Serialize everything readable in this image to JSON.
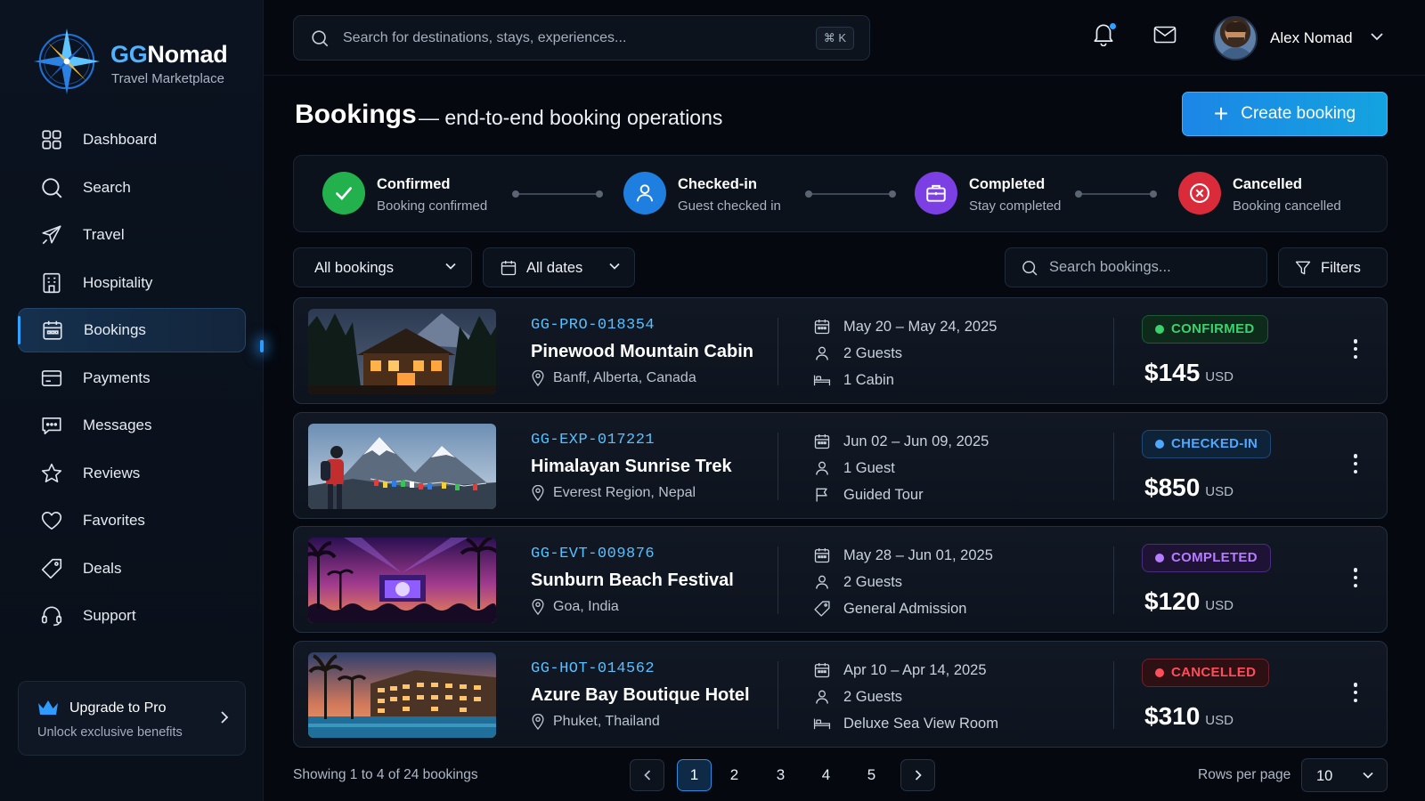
{
  "brand": {
    "name_part1": "GG",
    "name_part2": "Nomad",
    "subtitle": "Travel Marketplace"
  },
  "sidebar": {
    "items": [
      {
        "label": "Dashboard",
        "icon": "grid-icon"
      },
      {
        "label": "Search",
        "icon": "search-icon"
      },
      {
        "label": "Travel",
        "icon": "plane-icon"
      },
      {
        "label": "Hospitality",
        "icon": "building-icon"
      },
      {
        "label": "Bookings",
        "icon": "calendar-icon",
        "active": true
      },
      {
        "label": "Payments",
        "icon": "card-icon"
      },
      {
        "label": "Messages",
        "icon": "chat-icon"
      },
      {
        "label": "Reviews",
        "icon": "star-icon"
      },
      {
        "label": "Favorites",
        "icon": "heart-icon"
      },
      {
        "label": "Deals",
        "icon": "tag-icon"
      },
      {
        "label": "Support",
        "icon": "headset-icon"
      }
    ],
    "upgrade": {
      "title": "Upgrade to Pro",
      "subtitle": "Unlock exclusive benefits"
    }
  },
  "topbar": {
    "search_placeholder": "Search for destinations, stays, experiences...",
    "shortcut": "⌘ K",
    "user_name": "Alex Nomad"
  },
  "page": {
    "title": "Bookings",
    "subtitle": "— end-to-end booking operations",
    "create_button": "Create booking"
  },
  "steps": [
    {
      "title": "Confirmed",
      "subtitle": "Booking confirmed",
      "color": "#22b14c",
      "icon": "check-icon"
    },
    {
      "title": "Checked-in",
      "subtitle": "Guest checked in",
      "color": "#1f7fe0",
      "icon": "user-icon"
    },
    {
      "title": "Completed",
      "subtitle": "Stay completed",
      "color": "#7b3fe4",
      "icon": "briefcase-icon"
    },
    {
      "title": "Cancelled",
      "subtitle": "Booking cancelled",
      "color": "#d92b3a",
      "icon": "x-circle-icon"
    }
  ],
  "filters": {
    "type_select": "All bookings",
    "date_select": "All dates",
    "search_placeholder": "Search bookings...",
    "filters_button": "Filters"
  },
  "bookings": [
    {
      "code": "GG-PRO-018354",
      "name": "Pinewood Mountain Cabin",
      "location": "Banff, Alberta, Canada",
      "dates": "May 20 – May 24, 2025",
      "guests": "2 Guests",
      "extra": "1 Cabin",
      "extra_icon": "bed-icon",
      "status": "CONFIRMED",
      "status_color": "#3bd16f",
      "status_bg": "#0e2a1b",
      "status_border": "#1d5a35",
      "price": "$145",
      "currency": "USD",
      "thumb": "cabin"
    },
    {
      "code": "GG-EXP-017221",
      "name": "Himalayan Sunrise Trek",
      "location": "Everest Region, Nepal",
      "dates": "Jun 02 – Jun 09, 2025",
      "guests": "1 Guest",
      "extra": "Guided Tour",
      "extra_icon": "flag-icon",
      "status": "CHECKED-IN",
      "status_color": "#4ea8ff",
      "status_bg": "#0e2238",
      "status_border": "#1f4a78",
      "price": "$850",
      "currency": "USD",
      "thumb": "mountain"
    },
    {
      "code": "GG-EVT-009876",
      "name": "Sunburn Beach Festival",
      "location": "Goa, India",
      "dates": "May 28 – Jun 01, 2025",
      "guests": "2 Guests",
      "extra": "General Admission",
      "extra_icon": "ticket-icon",
      "status": "COMPLETED",
      "status_color": "#b57cff",
      "status_bg": "#1f1335",
      "status_border": "#4a2d7d",
      "price": "$120",
      "currency": "USD",
      "thumb": "festival"
    },
    {
      "code": "GG-HOT-014562",
      "name": "Azure Bay Boutique Hotel",
      "location": "Phuket, Thailand",
      "dates": "Apr 10 – Apr 14, 2025",
      "guests": "2 Guests",
      "extra": "Deluxe Sea View Room",
      "extra_icon": "bed-icon",
      "status": "CANCELLED",
      "status_color": "#ff4d5a",
      "status_bg": "#2d1014",
      "status_border": "#6b222b",
      "price": "$310",
      "currency": "USD",
      "thumb": "hotel"
    }
  ],
  "pagination": {
    "showing": "Showing 1 to 4 of 24 bookings",
    "pages": [
      "1",
      "2",
      "3",
      "4",
      "5"
    ],
    "current": "1",
    "rows_label": "Rows per page",
    "rows_value": "10"
  }
}
